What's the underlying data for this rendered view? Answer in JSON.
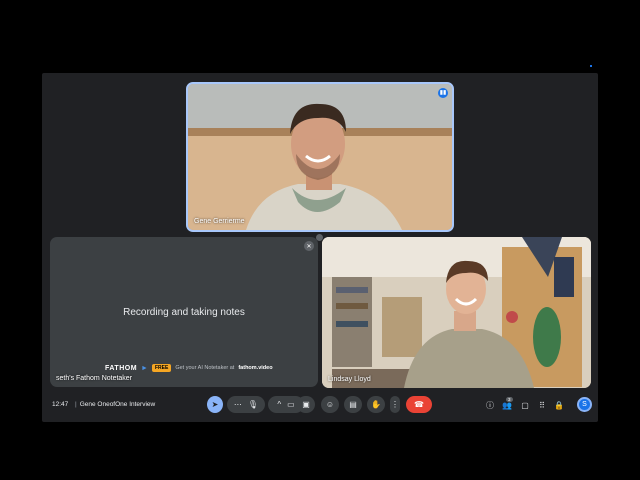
{
  "participants": {
    "top": {
      "name": "Gene Gerrierme"
    },
    "bottom_left": {
      "name": "seth's Fathom Notetaker"
    },
    "bottom_right": {
      "name": "Lindsay Lloyd"
    }
  },
  "notetaker": {
    "status": "Recording and taking notes",
    "brand": "FATHOM",
    "badge": "FREE",
    "promo_prefix": "Get your AI Notetaker at",
    "promo_url": "fathom.video"
  },
  "toolbar": {
    "time": "12:47",
    "separator": "|",
    "meeting_title": "Gene OneofOne Interview",
    "people_count": "3",
    "avatar_initial": "S"
  },
  "colors": {
    "accent": "#1a73e8",
    "end_call": "#ea4335",
    "active_border": "#a8c7fa"
  }
}
